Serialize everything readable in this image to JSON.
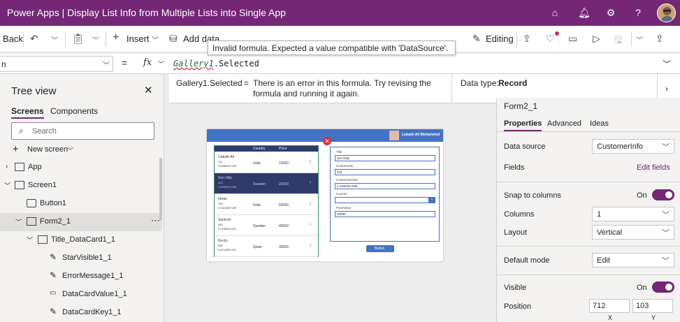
{
  "app": {
    "title": "Power Apps  |  Display List Info from Multiple Lists into Single App"
  },
  "commandbar": {
    "back": "Back",
    "insert": "Insert",
    "add_data": "Add data",
    "edit_fields": "Edit fields",
    "editing": "Editing"
  },
  "formula": {
    "property": "n",
    "fx": "fx",
    "text_part1": "Gallery1",
    "text_part2": ".Selected",
    "tooltip": "Invalid formula. Expected a value compatible with 'DataSource'.",
    "error_expr": "Gallery1.Selected",
    "error_eq": "=",
    "error_msg_line1": "There is an error in this formula. Try revising the",
    "error_msg_line2": "formula and running it again.",
    "datatype_label": "Data type:",
    "datatype_value": "Record"
  },
  "tree": {
    "title": "Tree view",
    "tabs": [
      "Screens",
      "Components"
    ],
    "search_placeholder": "Search",
    "new_screen": "New screen",
    "items": [
      {
        "label": "App"
      },
      {
        "label": "Screen1"
      },
      {
        "label": "Button1"
      },
      {
        "label": "Form2_1"
      },
      {
        "label": "Title_DataCard1_1"
      },
      {
        "label": "StarVisible1_1"
      },
      {
        "label": "ErrorMessage1_1"
      },
      {
        "label": "DataCardValue1_1"
      },
      {
        "label": "DataCardKey1_1"
      }
    ]
  },
  "canvas": {
    "header_user": "Liakath Ali Mohammed",
    "gallery_cols": [
      "Country",
      "Price"
    ],
    "gallery_rows": [
      {
        "name": "Liakath Ali",
        "id": "111",
        "phone": "9.53887E+009",
        "country": "India",
        "price": "10000"
      },
      {
        "name": "Son Dilip",
        "id": "222",
        "phone": "1.23457E+009",
        "country": "Sweden",
        "price": "20000"
      },
      {
        "name": "Imran",
        "id": "333",
        "phone": "5.45216E+009",
        "country": "India",
        "price": "50000"
      },
      {
        "name": "Santosh",
        "id": "444",
        "phone": "5.21354E+011",
        "country": "Sweden",
        "price": "40000"
      },
      {
        "name": "Rocky",
        "id": "555",
        "phone": "6.87126E+011",
        "country": "Spain",
        "price": "30000"
      }
    ],
    "form_fields": [
      {
        "label": "Title",
        "value": "Son Dilip"
      },
      {
        "label": "CustomerID",
        "value": "222"
      },
      {
        "label": "ContactNumber",
        "value": "1.23457E+009"
      },
      {
        "label": "Country",
        "value": ""
      },
      {
        "label": "PriceValue",
        "value": "20000"
      }
    ],
    "button": "Button"
  },
  "props": {
    "control_name": "Form2_1",
    "tabs": [
      "Properties",
      "Advanced",
      "Ideas"
    ],
    "data_source_label": "Data source",
    "data_source_value": "CustomerInfo",
    "fields_label": "Fields",
    "fields_link": "Edit fields",
    "snap_label": "Snap to columns",
    "snap_value": "On",
    "columns_label": "Columns",
    "columns_value": "1",
    "layout_label": "Layout",
    "layout_value": "Vertical",
    "default_mode_label": "Default mode",
    "default_mode_value": "Edit",
    "visible_label": "Visible",
    "visible_value": "On",
    "position_label": "Position",
    "position_x": "712",
    "position_y": "103",
    "x_label": "X",
    "y_label": "Y"
  },
  "colors": {
    "brand": "#742774",
    "selection": "#e5dfec"
  }
}
